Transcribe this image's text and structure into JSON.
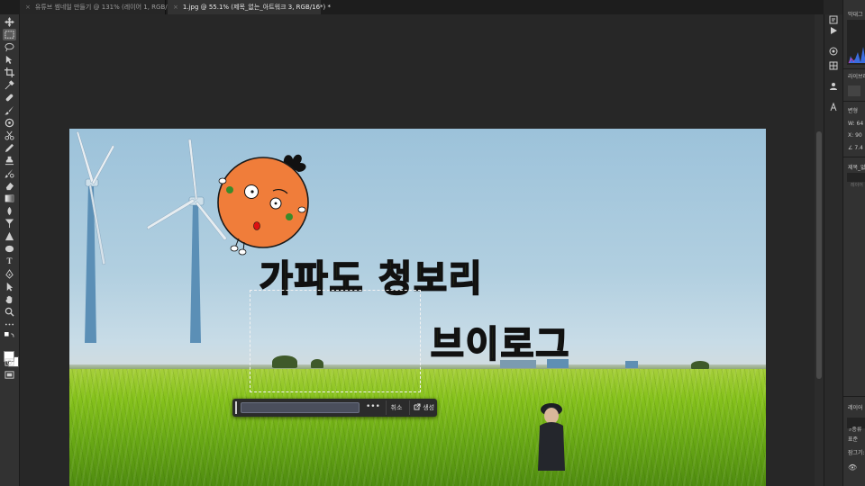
{
  "tabs": [
    {
      "label": "유튜브 썸네일 만들기 @ 131% (레이어 1, RGB/8) *",
      "close": "×"
    },
    {
      "label": "1.jpg @ 55.1% (제목_없는_아트워크 3, RGB/16*) *",
      "close": "×"
    }
  ],
  "tools": [
    "move-icon",
    "marquee-icon",
    "lasso-icon",
    "object-select-icon",
    "crop-icon",
    "eyedropper-icon",
    "healing-icon",
    "brush-icon",
    "stamp-icon",
    "scissors-icon",
    "pencil-icon",
    "clone-stamp-icon",
    "history-brush-icon",
    "eraser-icon",
    "gradient-icon",
    "smudge-icon",
    "dodge-icon",
    "burn-icon",
    "type-icon",
    "pen-icon",
    "path-select-icon",
    "hand-icon",
    "zoom-icon",
    "more-icon"
  ],
  "toolbar": {
    "type_tool_label": "T"
  },
  "canvas": {
    "headline_line1": "가파도 청보리",
    "headline_line2": "브이로그"
  },
  "taskbar": {
    "more": "•••",
    "cancel": "취소",
    "generate": "생성"
  },
  "right_panel": {
    "histogram_title": "막대그",
    "libraries_label": "라이브러",
    "properties_title": "변형",
    "w_label": "W:",
    "w_value": "64",
    "x_label": "X:",
    "x_value": "90",
    "angle_value": "7.4",
    "layer_name": "제목_없",
    "layer_sub": "레이어",
    "layers_title": "레이어",
    "search_label": "종류",
    "blend_mode": "표준",
    "lock_label": "잠그기:"
  },
  "colors": {
    "headline_fill": "#8fae1d",
    "headline_stroke": "#111111",
    "mascot_orange": "#f07d3a"
  }
}
